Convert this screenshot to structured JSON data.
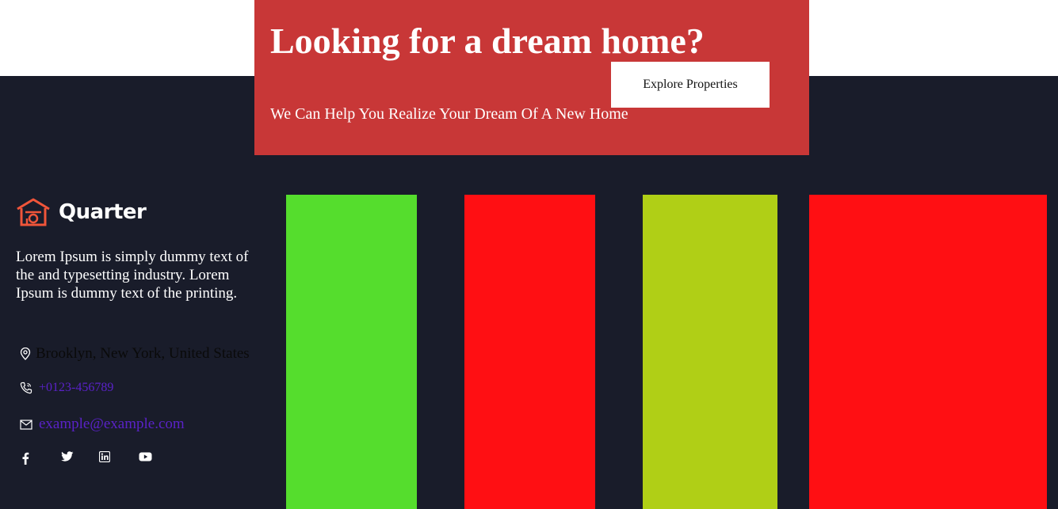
{
  "cta": {
    "title": "Looking for a dream home?",
    "subtitle": "We Can Help You Realize Your Dream Of A New Home",
    "button_label": "Explore Properties",
    "background": "#c83737"
  },
  "footer": {
    "background": "#191c2a",
    "brand": {
      "name": "Quarter",
      "icon": "house-logo-icon",
      "accent": "#f0553a"
    },
    "about": "Lorem Ipsum is simply dummy text of the and typesetting industry. Lorem Ipsum is dummy text of the printing.",
    "contact": {
      "address": "Brooklyn, New York, United States",
      "phone": "+0123-456789",
      "email": "example@example.com",
      "address_icon": "location-pin-icon",
      "phone_icon": "phone-icon",
      "email_icon": "envelope-icon"
    },
    "social": [
      {
        "icon": "facebook-icon"
      },
      {
        "icon": "twitter-icon"
      },
      {
        "icon": "linkedin-icon"
      },
      {
        "icon": "youtube-icon"
      }
    ]
  },
  "color_blocks": [
    {
      "color": "#55dd2d"
    },
    {
      "color": "#ff0f13"
    },
    {
      "color": "#b0cf16"
    },
    {
      "color": "#ff0f13"
    }
  ]
}
